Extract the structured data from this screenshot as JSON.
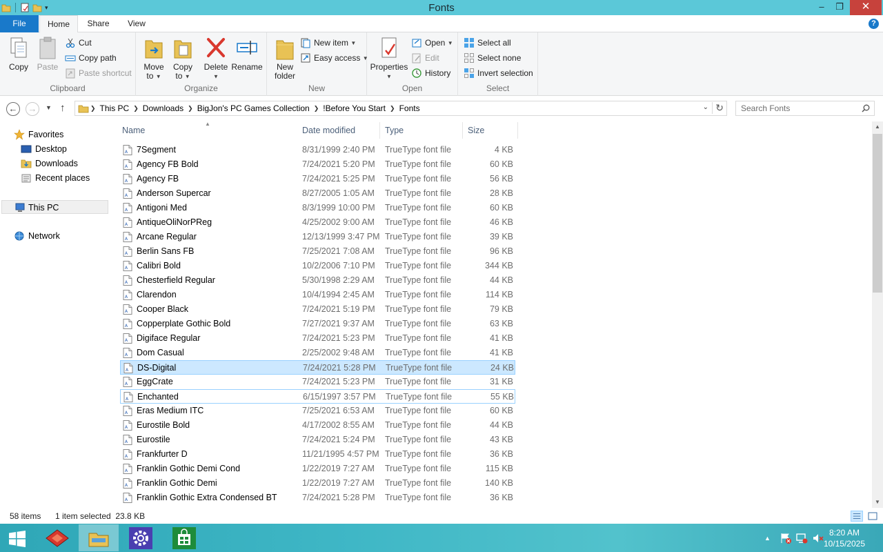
{
  "window": {
    "title": "Fonts"
  },
  "ribbon_tabs": {
    "file": "File",
    "home": "Home",
    "share": "Share",
    "view": "View"
  },
  "ribbon": {
    "clipboard": {
      "label": "Clipboard",
      "copy": "Copy",
      "paste": "Paste",
      "cut": "Cut",
      "copy_path": "Copy path",
      "paste_shortcut": "Paste shortcut"
    },
    "organize": {
      "label": "Organize",
      "move_to_1": "Move",
      "move_to_2": "to",
      "copy_to_1": "Copy",
      "copy_to_2": "to",
      "delete": "Delete",
      "rename": "Rename"
    },
    "new": {
      "label": "New",
      "new_folder_1": "New",
      "new_folder_2": "folder",
      "new_item": "New item",
      "easy_access": "Easy access"
    },
    "open": {
      "label": "Open",
      "properties": "Properties",
      "open": "Open",
      "edit": "Edit",
      "history": "History"
    },
    "select": {
      "label": "Select",
      "select_all": "Select all",
      "select_none": "Select none",
      "invert_selection": "Invert selection"
    }
  },
  "address": {
    "crumbs": [
      "This PC",
      "Downloads",
      "BigJon's PC Games Collection",
      "!Before You Start",
      "Fonts"
    ],
    "search_placeholder": "Search Fonts"
  },
  "nav_pane": {
    "favorites": "Favorites",
    "desktop": "Desktop",
    "downloads": "Downloads",
    "recent": "Recent places",
    "this_pc": "This PC",
    "network": "Network"
  },
  "columns": {
    "name": "Name",
    "date": "Date modified",
    "type": "Type",
    "size": "Size"
  },
  "files": [
    {
      "name": "7Segment",
      "date": "8/31/1999 2:40 PM",
      "type": "TrueType font file",
      "size": "4 KB"
    },
    {
      "name": "Agency FB Bold",
      "date": "7/24/2021 5:20 PM",
      "type": "TrueType font file",
      "size": "60 KB"
    },
    {
      "name": "Agency FB",
      "date": "7/24/2021 5:25 PM",
      "type": "TrueType font file",
      "size": "56 KB"
    },
    {
      "name": "Anderson Supercar",
      "date": "8/27/2005 1:05 AM",
      "type": "TrueType font file",
      "size": "28 KB"
    },
    {
      "name": "Antigoni Med",
      "date": "8/3/1999 10:00 PM",
      "type": "TrueType font file",
      "size": "60 KB"
    },
    {
      "name": "AntiqueOliNorPReg",
      "date": "4/25/2002 9:00 AM",
      "type": "TrueType font file",
      "size": "46 KB"
    },
    {
      "name": "Arcane Regular",
      "date": "12/13/1999 3:47 PM",
      "type": "TrueType font file",
      "size": "39 KB"
    },
    {
      "name": "Berlin Sans FB",
      "date": "7/25/2021 7:08 AM",
      "type": "TrueType font file",
      "size": "96 KB"
    },
    {
      "name": "Calibri Bold",
      "date": "10/2/2006 7:10 PM",
      "type": "TrueType font file",
      "size": "344 KB"
    },
    {
      "name": "Chesterfield Regular",
      "date": "5/30/1998 2:29 AM",
      "type": "TrueType font file",
      "size": "44 KB"
    },
    {
      "name": "Clarendon",
      "date": "10/4/1994 2:45 AM",
      "type": "TrueType font file",
      "size": "114 KB"
    },
    {
      "name": "Cooper Black",
      "date": "7/24/2021 5:19 PM",
      "type": "TrueType font file",
      "size": "79 KB"
    },
    {
      "name": "Copperplate Gothic Bold",
      "date": "7/27/2021 9:37 AM",
      "type": "TrueType font file",
      "size": "63 KB"
    },
    {
      "name": "Digiface Regular",
      "date": "7/24/2021 5:23 PM",
      "type": "TrueType font file",
      "size": "41 KB"
    },
    {
      "name": "Dom Casual",
      "date": "2/25/2002 9:48 AM",
      "type": "TrueType font file",
      "size": "41 KB"
    },
    {
      "name": "DS-Digital",
      "date": "7/24/2021 5:28 PM",
      "type": "TrueType font file",
      "size": "24 KB"
    },
    {
      "name": "EggCrate",
      "date": "7/24/2021 5:23 PM",
      "type": "TrueType font file",
      "size": "31 KB"
    },
    {
      "name": "Enchanted",
      "date": "6/15/1997 3:57 PM",
      "type": "TrueType font file",
      "size": "55 KB"
    },
    {
      "name": "Eras Medium ITC",
      "date": "7/25/2021 6:53 AM",
      "type": "TrueType font file",
      "size": "60 KB"
    },
    {
      "name": "Eurostile Bold",
      "date": "4/17/2002 8:55 AM",
      "type": "TrueType font file",
      "size": "44 KB"
    },
    {
      "name": "Eurostile",
      "date": "7/24/2021 5:24 PM",
      "type": "TrueType font file",
      "size": "43 KB"
    },
    {
      "name": "Frankfurter D",
      "date": "11/21/1995 4:57 PM",
      "type": "TrueType font file",
      "size": "36 KB"
    },
    {
      "name": "Franklin Gothic Demi Cond",
      "date": "1/22/2019 7:27 AM",
      "type": "TrueType font file",
      "size": "115 KB"
    },
    {
      "name": "Franklin Gothic Demi",
      "date": "1/22/2019 7:27 AM",
      "type": "TrueType font file",
      "size": "140 KB"
    },
    {
      "name": "Franklin Gothic Extra Condensed BT",
      "date": "7/24/2021 5:28 PM",
      "type": "TrueType font file",
      "size": "36 KB"
    }
  ],
  "selected_index": 15,
  "focused_index": 17,
  "status": {
    "items": "58 items",
    "selected": "1 item selected  23.8 KB"
  },
  "clock": {
    "time": "8:20 AM",
    "date": "10/15/2025"
  },
  "colors": {
    "titlebar": "#5bc8d8",
    "accent": "#1979ca",
    "selection": "#cce8ff",
    "close": "#c7423c"
  }
}
